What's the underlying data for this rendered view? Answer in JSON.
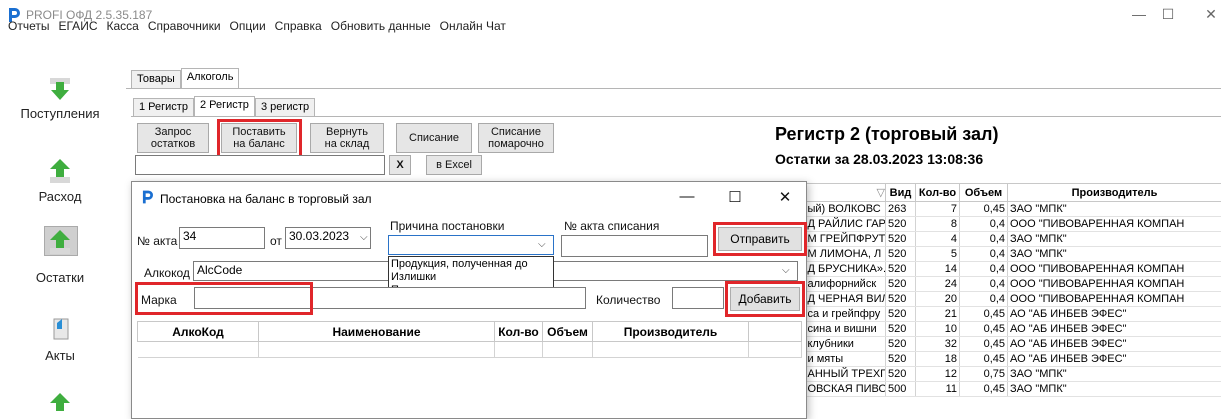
{
  "window": {
    "title": "PROFI ОФД 2.5.35.187",
    "controls": {
      "minimize": "—",
      "maximize": "☐",
      "close": "✕"
    }
  },
  "menu": [
    "Отчеты",
    "ЕГАИС",
    "Касса",
    "Справочники",
    "Опции",
    "Справка",
    "Обновить данные",
    "Онлайн Чат"
  ],
  "sidebar": {
    "items": [
      {
        "label": "Поступления",
        "icon": "arrow-down-icon"
      },
      {
        "label": "Расход",
        "icon": "arrow-up-icon"
      },
      {
        "label": "Остатки",
        "icon": "arrow-up-icon"
      },
      {
        "label": "Акты",
        "icon": "document-icon"
      },
      {
        "label": "",
        "icon": "arrow-up-icon"
      }
    ]
  },
  "tabs_top": [
    "Товары",
    "Алкоголь"
  ],
  "tabs_sub": [
    "1 Регистр",
    "2 Регистр",
    "3 регистр"
  ],
  "toolbar": {
    "request_l1": "Запрос",
    "request_l2": "остатков",
    "put_l1": "Поставить",
    "put_l2": "на баланс",
    "return_l1": "Вернуть",
    "return_l2": "на склад",
    "writeoff": "Списание",
    "writeoff_item_l1": "Списание",
    "writeoff_item_l2": "помарочно",
    "clear": "X",
    "excel": "в Excel"
  },
  "register": {
    "title": "Регистр  2 (торговый зал)",
    "subtitle": "Остатки за 28.03.2023 13:08:36"
  },
  "bg_table": {
    "headers": [
      "",
      "Вид",
      "Кол-во",
      "Объем",
      "Производитель"
    ],
    "rows": [
      [
        "ый) ВОЛКОВС",
        "263",
        "7",
        "0,45",
        "ЗАО \"МПК\""
      ],
      [
        "Д РАЙЛИС ГАР",
        "520",
        "8",
        "0,4",
        "ООО \"ПИВОВАРЕННАЯ КОМПАН"
      ],
      [
        "М ГРЕЙПФРУТА",
        "520",
        "4",
        "0,4",
        "ЗАО \"МПК\""
      ],
      [
        "М ЛИМОНА, Л",
        "520",
        "5",
        "0,4",
        "ЗАО \"МПК\""
      ],
      [
        "Д БРУСНИКА».",
        "520",
        "14",
        "0,4",
        "ООО \"ПИВОВАРЕННАЯ КОМПАН"
      ],
      [
        "алифорнийск",
        "520",
        "24",
        "0,4",
        "ООО \"ПИВОВАРЕННАЯ КОМПАН"
      ],
      [
        "Д ЧЕРНАЯ ВИЛ",
        "520",
        "20",
        "0,4",
        "ООО \"ПИВОВАРЕННАЯ КОМПАН"
      ],
      [
        "са и грейпфру",
        "520",
        "21",
        "0,45",
        "АО \"АБ ИНБЕВ ЭФЕС\""
      ],
      [
        "сина и вишни",
        "520",
        "10",
        "0,45",
        "АО \"АБ ИНБЕВ ЭФЕС\""
      ],
      [
        " клубники",
        "520",
        "32",
        "0,45",
        "АО \"АБ ИНБЕВ ЭФЕС\""
      ],
      [
        " и мяты",
        "520",
        "18",
        "0,45",
        "АО \"АБ ИНБЕВ ЭФЕС\""
      ],
      [
        "АННЫЙ ТРЕХГО",
        "520",
        "12",
        "0,75",
        "ЗАО \"МПК\""
      ],
      [
        "ОВСКАЯ ПИВО",
        "500",
        "11",
        "0,45",
        "ЗАО \"МПК\""
      ]
    ]
  },
  "dialog": {
    "title": "Постановка на баланс в торговый зал",
    "act_label": "№ акта",
    "act_value": "34",
    "from_label": "от",
    "date_value": "30.03.2023",
    "reason_label": "Причина постановки",
    "writeoff_act_label": "№ акта списания",
    "send": "Отправить",
    "alcocode_label": "Алкокод",
    "alcocode_value": "AlcCode",
    "reason_options": [
      "Продукция, полученная до",
      "Излишки",
      "Пересортица"
    ],
    "mark_label": "Марка",
    "qty_label": "Количество",
    "add": "Добавить",
    "table_headers": [
      "АлкоКод",
      "Наименование",
      "Кол-во",
      "Объем",
      "Производитель"
    ]
  },
  "colors": {
    "highlight": "#e0262a",
    "logo": "#1a6fd1",
    "arrow_green": "#3fae3f"
  }
}
